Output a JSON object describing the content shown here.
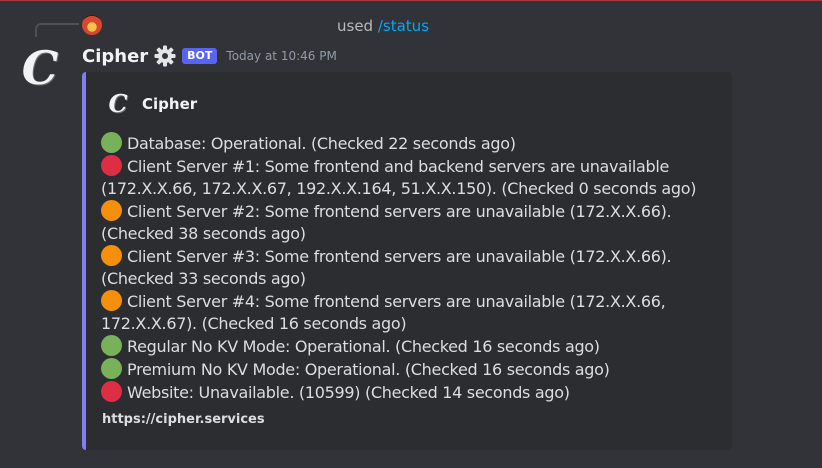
{
  "reply": {
    "prefix": "used",
    "command": "/status"
  },
  "message": {
    "username": "Cipher",
    "avatar_letter": "C",
    "bot_badge": "BOT",
    "timestamp": "Today at 10:46 PM"
  },
  "embed": {
    "accent_color": "#7f7ef2",
    "author_name": "Cipher",
    "author_icon_letter": "C",
    "lines": [
      {
        "status": "green",
        "text": "Database: Operational. (Checked 22 seconds ago)"
      },
      {
        "status": "red",
        "text": "Client Server #1: Some frontend and backend servers are unavailable (172.X.X.66, 172.X.X.67, 192.X.X.164, 51.X.X.150). (Checked 0 seconds ago)"
      },
      {
        "status": "orange",
        "text": "Client Server #2: Some frontend servers are unavailable (172.X.X.66). (Checked 38 seconds ago)"
      },
      {
        "status": "orange",
        "text": "Client Server #3: Some frontend servers are unavailable (172.X.X.66). (Checked 33 seconds ago)"
      },
      {
        "status": "orange",
        "text": "Client Server #4: Some frontend servers are unavailable (172.X.X.66, 172.X.X.67). (Checked 16 seconds ago)"
      },
      {
        "status": "green",
        "text": "Regular No KV Mode: Operational. (Checked 16 seconds ago)"
      },
      {
        "status": "green",
        "text": "Premium No KV Mode: Operational. (Checked 16 seconds ago)"
      },
      {
        "status": "red",
        "text": "Website: Unavailable. (10599) (Checked 14 seconds ago)"
      }
    ],
    "footer_link": "https://cipher.services"
  },
  "colors": {
    "status_green": "#78b159",
    "status_red": "#dd2e44",
    "status_orange": "#f4900c",
    "bot_badge": "#5865f2",
    "command_link": "#00a8fc"
  },
  "icons": {
    "verified_badge": "gear-icon",
    "status_indicator": "circle"
  }
}
